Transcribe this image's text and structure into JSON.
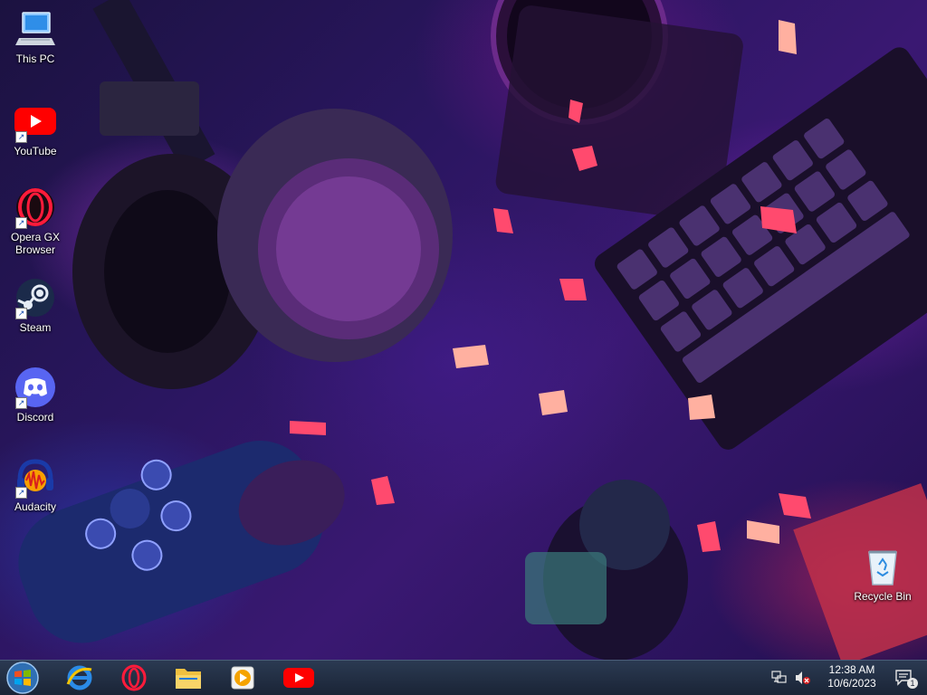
{
  "desktop": {
    "icons": [
      {
        "label": "This PC"
      },
      {
        "label": "YouTube"
      },
      {
        "label": "Opera GX Browser"
      },
      {
        "label": "Steam"
      },
      {
        "label": "Discord"
      },
      {
        "label": "Audacity"
      },
      {
        "label": "Recycle Bin"
      }
    ]
  },
  "taskbar": {
    "pinned": [
      {
        "name": "Internet Explorer"
      },
      {
        "name": "Opera GX"
      },
      {
        "name": "File Explorer"
      },
      {
        "name": "Media Player"
      },
      {
        "name": "YouTube"
      }
    ],
    "clock": {
      "time": "12:38 AM",
      "date": "10/6/2023"
    },
    "notification_badge": "1"
  },
  "colors": {
    "taskbar": "#1a2436",
    "youtube_red": "#ff0000",
    "opera_red": "#e0182d",
    "discord_blurple": "#5865f2"
  }
}
